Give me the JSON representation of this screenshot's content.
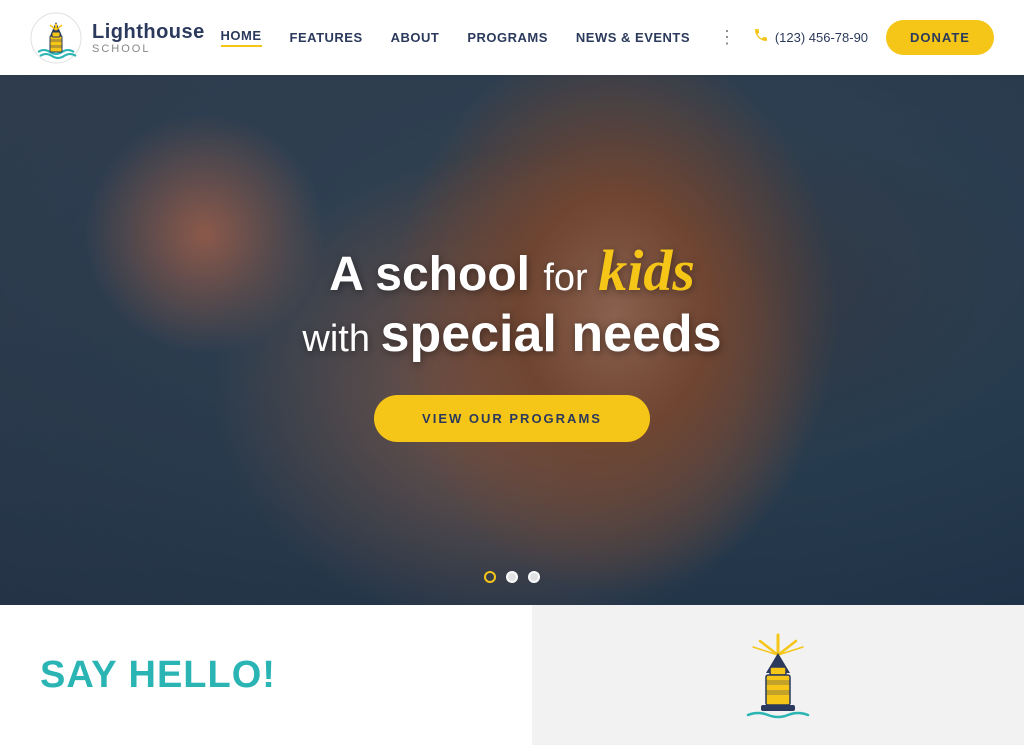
{
  "header": {
    "logo": {
      "name": "Lighthouse",
      "subtitle": "SCHOOL"
    },
    "nav": {
      "items": [
        {
          "label": "HOME",
          "active": true
        },
        {
          "label": "FEATURES",
          "active": false
        },
        {
          "label": "ABOUT",
          "active": false
        },
        {
          "label": "PROGRAMS",
          "active": false
        },
        {
          "label": "NEWS & EVENTS",
          "active": false
        }
      ],
      "more_icon": "⋮"
    },
    "phone": "(123) 456-78-90",
    "donate_label": "DONATE"
  },
  "hero": {
    "line1_before": "A school",
    "line1_for": "for",
    "line1_kids": "kids",
    "line2_with": "with",
    "line2_special": "special needs",
    "cta_label": "VIEW OUR PROGRAMS",
    "dots": [
      {
        "active": true
      },
      {
        "active": false
      },
      {
        "active": false
      }
    ]
  },
  "bottom": {
    "say_hello": "SAY HELLO!",
    "lighthouse_icon": "lighthouse"
  },
  "colors": {
    "yellow": "#f5c518",
    "teal": "#2ab4b4",
    "navy": "#2b3a5c"
  }
}
